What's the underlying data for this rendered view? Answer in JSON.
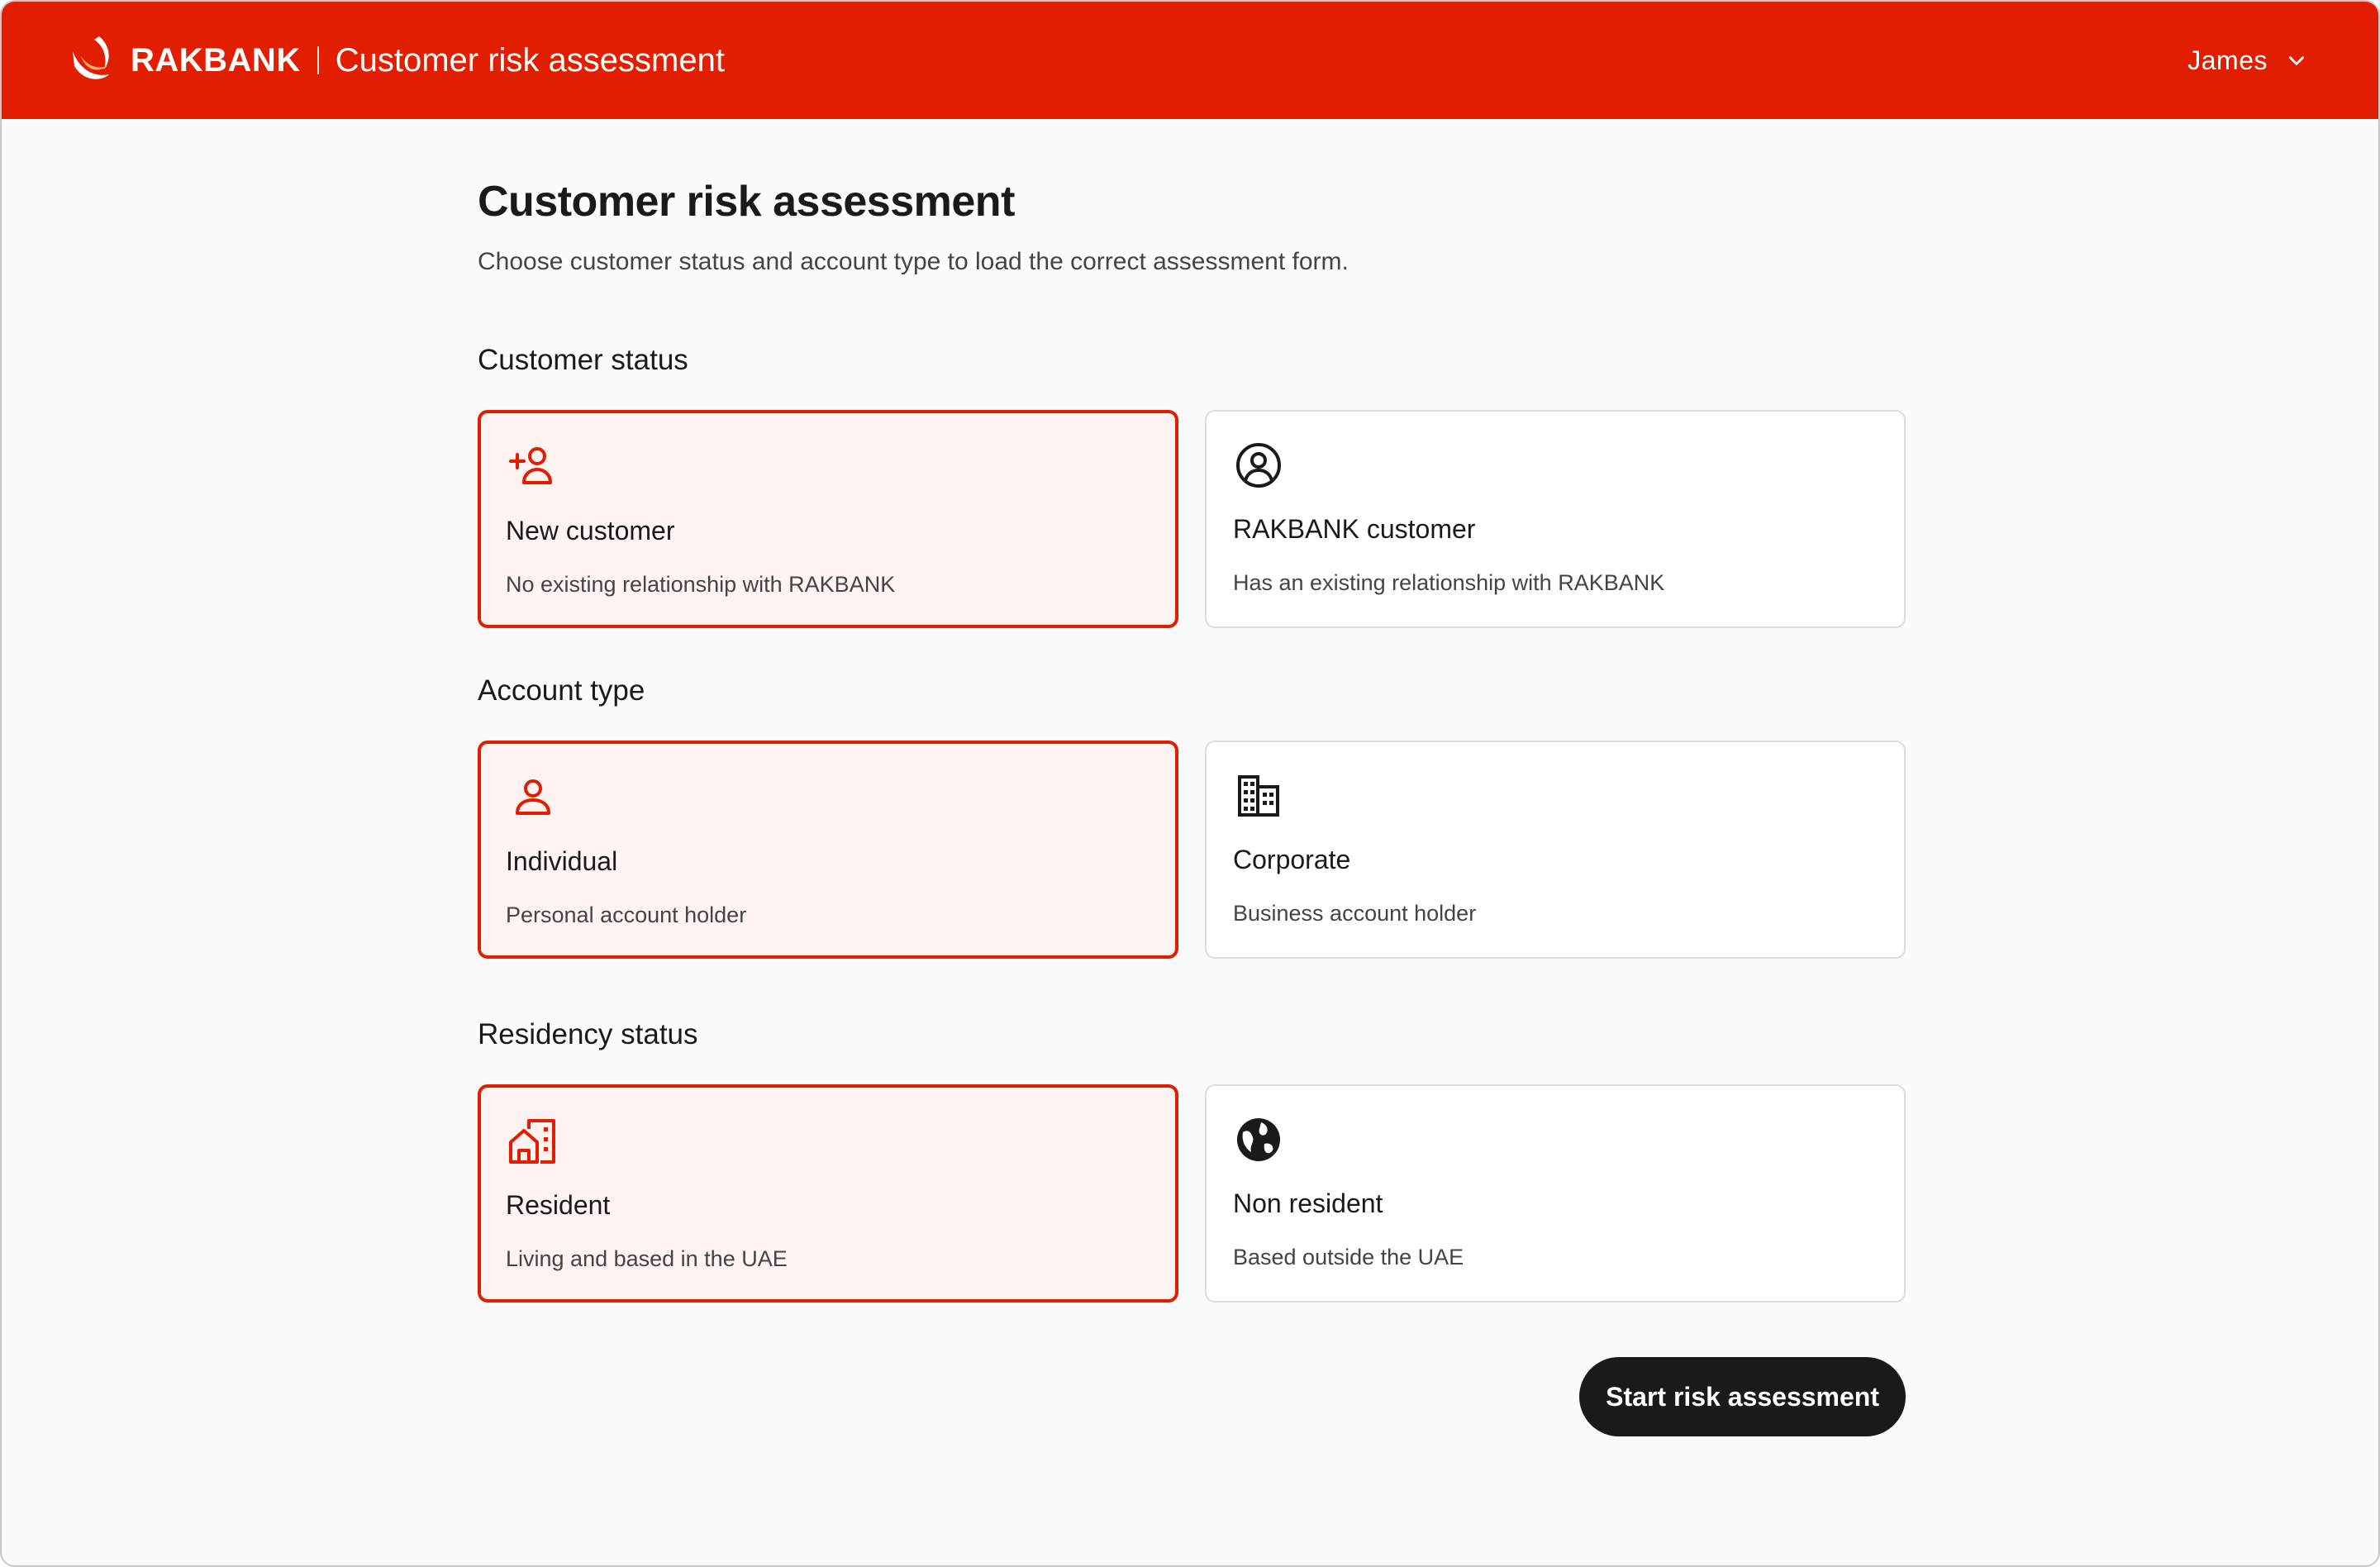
{
  "header": {
    "brand": "RAKBANK",
    "app_title": "Customer risk assessment",
    "user_name": "James",
    "bg_color": "#e11e00"
  },
  "page": {
    "title": "Customer risk assessment",
    "subtitle": "Choose customer status and account type to load the correct assessment form."
  },
  "sections": {
    "customer_status": {
      "label": "Customer status",
      "options": [
        {
          "title": "New customer",
          "description": "No existing relationship with RAKBANK",
          "icon": "add-person-icon",
          "selected": true
        },
        {
          "title": "RAKBANK customer",
          "description": "Has an existing relationship with RAKBANK",
          "icon": "user-circle-icon",
          "selected": false
        }
      ]
    },
    "account_type": {
      "label": "Account type",
      "options": [
        {
          "title": "Individual",
          "description": "Personal account holder",
          "icon": "person-icon",
          "selected": true
        },
        {
          "title": "Corporate",
          "description": "Business account holder",
          "icon": "building-icon",
          "selected": false
        }
      ]
    },
    "residency_status": {
      "label": "Residency status",
      "options": [
        {
          "title": "Resident",
          "description": "Living and based in the UAE",
          "icon": "home-city-icon",
          "selected": true
        },
        {
          "title": "Non resident",
          "description": "Based outside the UAE",
          "icon": "globe-icon",
          "selected": false
        }
      ]
    }
  },
  "actions": {
    "start_label": "Start risk assessment"
  },
  "colors": {
    "accent": "#e11e00",
    "selected_bg": "#fff4f2",
    "button_bg": "#1a1a1a"
  }
}
